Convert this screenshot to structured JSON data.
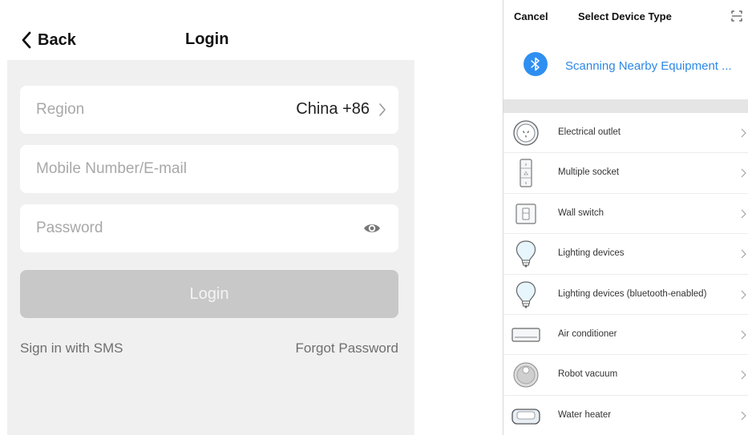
{
  "login": {
    "nav": {
      "back_label": "Back",
      "title": "Login"
    },
    "region": {
      "label": "Region",
      "value": "China +86"
    },
    "account": {
      "placeholder": "Mobile Number/E-mail",
      "value": ""
    },
    "password": {
      "placeholder": "Password",
      "value": ""
    },
    "login_button": "Login",
    "sms_link": "Sign in with SMS",
    "forgot_link": "Forgot Password"
  },
  "device_select": {
    "cancel": "Cancel",
    "title": "Select Device Type",
    "scanning_text": "Scanning Nearby Equipment ...",
    "accent_color": "#2f8ff0",
    "items": [
      {
        "label": "Electrical outlet",
        "icon": "outlet-icon"
      },
      {
        "label": "Multiple socket",
        "icon": "power-strip-icon"
      },
      {
        "label": "Wall switch",
        "icon": "wall-switch-icon"
      },
      {
        "label": "Lighting devices",
        "icon": "light-bulb-icon"
      },
      {
        "label": "Lighting devices (bluetooth-enabled)",
        "icon": "light-bulb-icon"
      },
      {
        "label": "Air conditioner",
        "icon": "air-conditioner-icon"
      },
      {
        "label": "Robot vacuum",
        "icon": "robot-vacuum-icon"
      },
      {
        "label": "Water heater",
        "icon": "water-heater-icon"
      }
    ]
  }
}
